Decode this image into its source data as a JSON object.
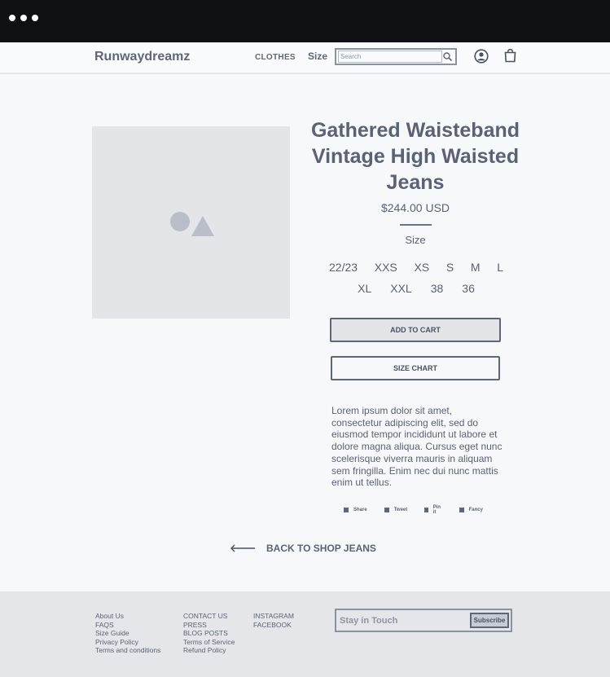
{
  "nav": {
    "brand": "Runwaydreamz",
    "clothes": "CLOTHES",
    "size": "Size",
    "search_placeholder": "Search"
  },
  "product": {
    "title": "Gathered Waisteband Vintage High Waisted Jeans",
    "price": "$244.00 USD",
    "size_label": "Size",
    "sizes_row1": [
      "22/23",
      "XXS",
      "XS",
      "S",
      "M",
      "L"
    ],
    "sizes_row2": [
      "XL",
      "XXL",
      "38",
      "36"
    ],
    "add_to_cart": "ADD TO CART",
    "size_chart": "SIZE CHART",
    "description": "Lorem ipsum dolor sit amet, consectetur adipiscing elit, sed do eiusmod tempor incididunt ut labore et dolore magna aliqua. Cursus eget nunc scelerisque viverra mauris in aliquam sem fringilla. Enim nec dui nunc mattis enim ut tellus.",
    "social": [
      "Share",
      "Tweet",
      "Pin it",
      "Fancy"
    ]
  },
  "back_link": "BACK TO SHOP JEANS",
  "footer": {
    "col1": [
      "About Us",
      "FAQS",
      "Size Guide",
      "Privacy Policy",
      "Terms and conditions"
    ],
    "col2": [
      "CONTACT US",
      "PRESS",
      "BLOG POSTS",
      "Terms of Service",
      "Refund Policy"
    ],
    "col3": [
      "INSTAGRAM",
      "FACEBOOK"
    ],
    "newsletter_placeholder": "Stay in Touch",
    "subscribe": "Subscribe"
  },
  "colors": {
    "text": "#5a6275",
    "chrome": "#0f1013",
    "placeholder_bg": "#e3e5e9",
    "footer_bg": "#e4e6ea"
  }
}
